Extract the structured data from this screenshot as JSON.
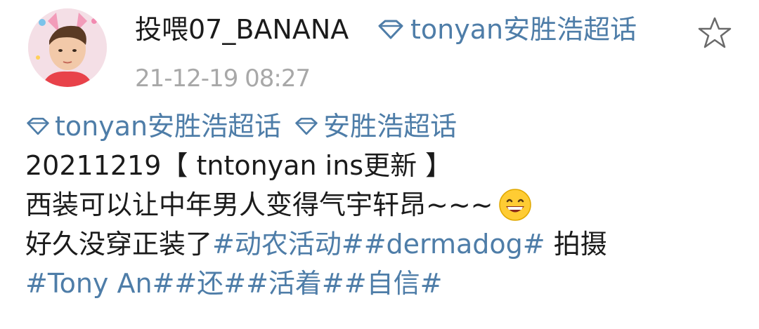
{
  "post": {
    "username": "投喂07_BANANA",
    "source_label": "tonyan安胜浩超话",
    "timestamp": "21-12-19 08:27",
    "topics": [
      "tonyan安胜浩超话",
      "安胜浩超话"
    ],
    "line2": "20211219【 tntonyan ins更新 】",
    "line3_text": "西装可以让中年男人变得气宇轩昂~~~",
    "line3_emoji": "grinning-emoji",
    "line4_prefix": "好久没穿正装了",
    "line4_tags": "#动农活动##dermadog#",
    "line4_suffix": " 拍摄",
    "line5_tags": "#Tony An##还##活着##自信#"
  },
  "colors": {
    "link": "#4e7da8",
    "timestamp": "#a8a8a8",
    "text": "#1b1b1b"
  },
  "icons": {
    "source": "diamond-icon",
    "favorite": "star-outline-icon"
  }
}
